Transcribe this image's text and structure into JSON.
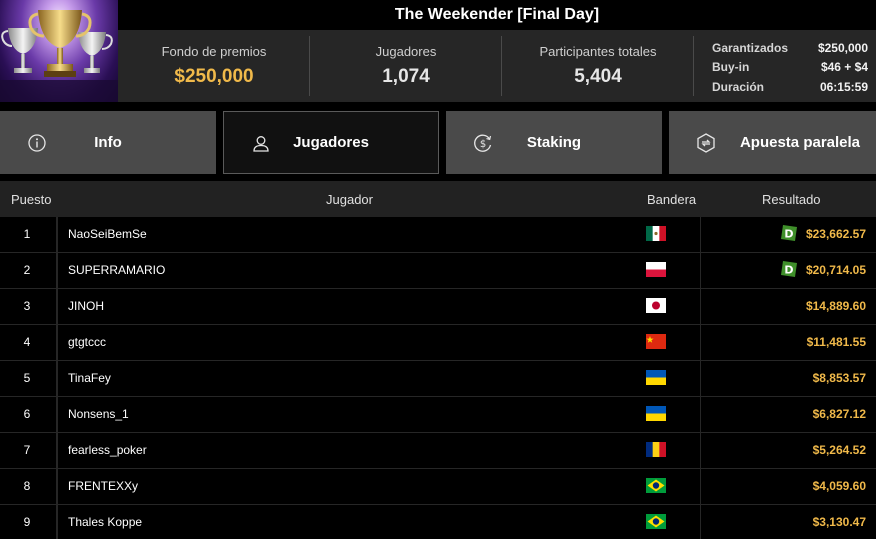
{
  "header": {
    "title": "The Weekender [Final Day]",
    "stats": [
      {
        "label": "Fondo de premios",
        "value": "$250,000"
      },
      {
        "label": "Jugadores",
        "value": "1,074"
      },
      {
        "label": "Participantes totales",
        "value": "5,404"
      }
    ],
    "details": [
      {
        "key": "Garantizados",
        "value": "$250,000"
      },
      {
        "key": "Buy-in",
        "value": "$46 + $4"
      },
      {
        "key": "Duración",
        "value": "06:15:59"
      }
    ]
  },
  "tabs": [
    {
      "label": "Info",
      "icon": "info-icon"
    },
    {
      "label": "Jugadores",
      "icon": "user-icon",
      "active": true
    },
    {
      "label": "Staking",
      "icon": "staking-coin-icon"
    },
    {
      "label": "Apuesta paralela",
      "icon": "side-bet-icon"
    }
  ],
  "table": {
    "headers": {
      "pos": "Puesto",
      "player": "Jugador",
      "flag": "Bandera",
      "result": "Resultado"
    },
    "rows": [
      {
        "pos": "1",
        "name": "NaoSeiBemSe",
        "flag": "mexico-flag",
        "prize": "$23,662.57",
        "badge": true
      },
      {
        "pos": "2",
        "name": "SUPERRAMARIO",
        "flag": "poland-flag",
        "prize": "$20,714.05",
        "badge": true
      },
      {
        "pos": "3",
        "name": "JINOH",
        "flag": "japan-flag",
        "prize": "$14,889.60",
        "badge": false
      },
      {
        "pos": "4",
        "name": "gtgtccc",
        "flag": "china-flag",
        "prize": "$11,481.55",
        "badge": false
      },
      {
        "pos": "5",
        "name": "TinaFey",
        "flag": "ukraine-flag",
        "prize": "$8,853.57",
        "badge": false
      },
      {
        "pos": "6",
        "name": "Nonsens_1",
        "flag": "ukraine-flag",
        "prize": "$6,827.12",
        "badge": false
      },
      {
        "pos": "7",
        "name": "fearless_poker",
        "flag": "romania-flag",
        "prize": "$5,264.52",
        "badge": false
      },
      {
        "pos": "8",
        "name": "FRENTEXXy",
        "flag": "brazil-flag",
        "prize": "$4,059.60",
        "badge": false
      },
      {
        "pos": "9",
        "name": "Thales Koppe",
        "flag": "brazil-flag",
        "prize": "$3,130.47",
        "badge": false
      }
    ]
  },
  "colors": {
    "accent": "#f0b94a",
    "badge": "#3f8f2a",
    "tab_bg": "#4a4a4a",
    "header_bg": "#262626"
  }
}
